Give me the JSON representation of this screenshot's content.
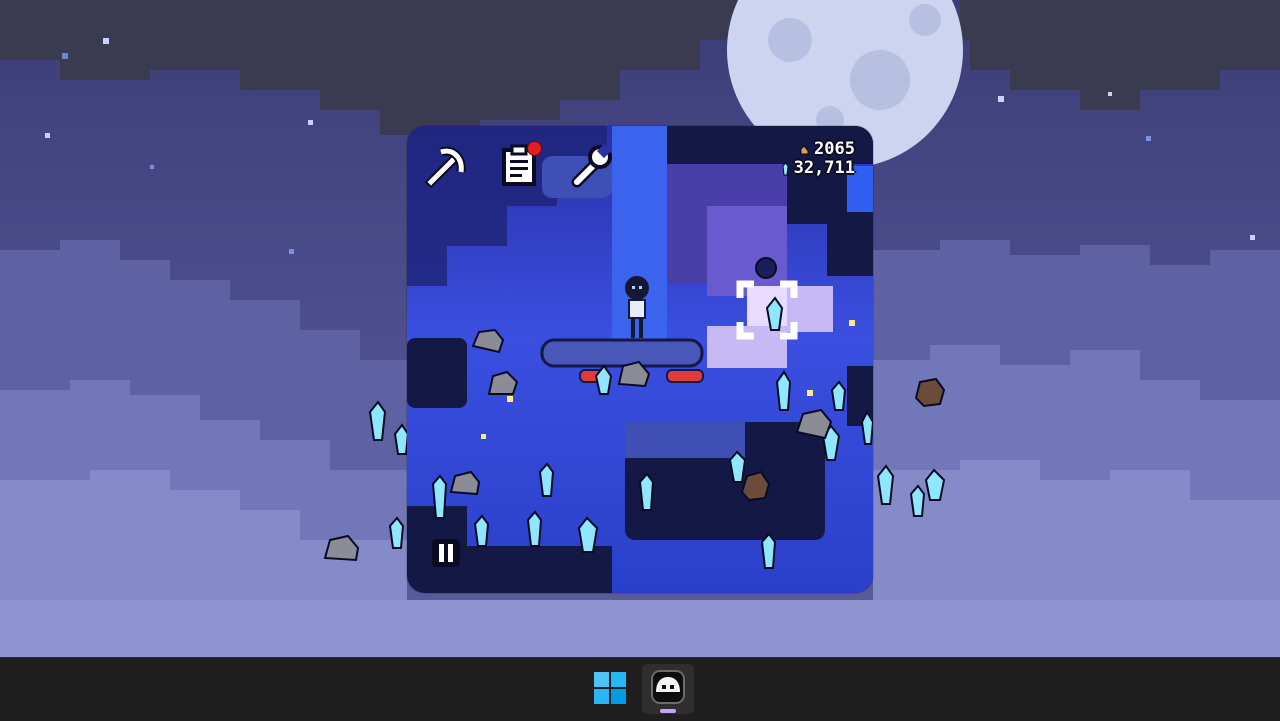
{
  "game": {
    "counters": {
      "stone_count": "2065",
      "crystal_count": "32,711"
    },
    "toolbar": [
      {
        "id": "pickaxe",
        "icon": "pickaxe-icon"
      },
      {
        "id": "notes",
        "icon": "notes-icon",
        "has_notification": true
      },
      {
        "id": "settings",
        "icon": "wrench-icon"
      }
    ],
    "pause_icon": "pause-icon"
  },
  "taskbar": {
    "apps": [
      {
        "icon": "windows-start-icon"
      },
      {
        "icon": "game-app-icon",
        "active": true
      }
    ]
  },
  "colors": {
    "sky": "#4b4d8a",
    "moon": "#cdd4f0",
    "crystal": "#8fe6ff",
    "notification": "#e51f1f",
    "taskbar": "#1f1f1f",
    "accent": "#c7a2ff"
  }
}
